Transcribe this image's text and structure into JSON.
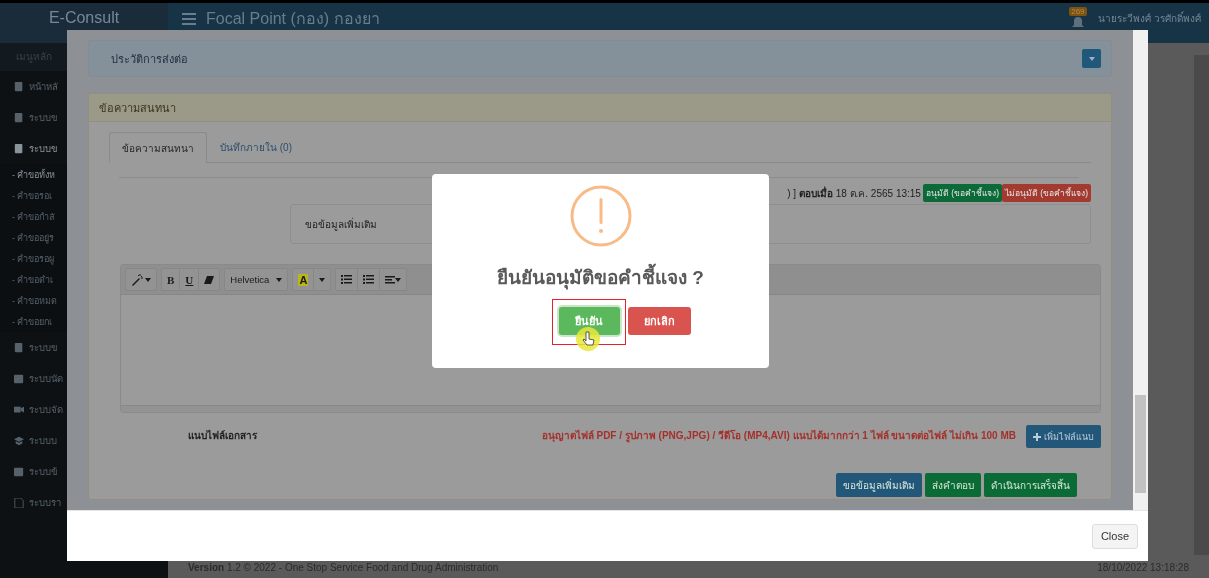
{
  "header": {
    "brand": "E-Consult",
    "title": "Focal Point (กอง) กองยา",
    "notification_count": "269",
    "user": "นายระวีพงศ์ วรศักดิ์พงศ์"
  },
  "sidebar": {
    "heading": "เมนูหลัก",
    "items": [
      {
        "kind": "main",
        "label": "หน้าหลั",
        "selected": false
      },
      {
        "kind": "main",
        "label": "ระบบข",
        "selected": false
      },
      {
        "kind": "main",
        "label": "ระบบข",
        "selected": true
      },
      {
        "kind": "sub",
        "label": "- คำขอทั้งห",
        "selected": true
      },
      {
        "kind": "sub",
        "label": "- คำขอรอเ",
        "selected": false
      },
      {
        "kind": "sub",
        "label": "- คำขอกำลั",
        "selected": false
      },
      {
        "kind": "sub",
        "label": "- คำขออยู่ร",
        "selected": false
      },
      {
        "kind": "sub",
        "label": "- คำขอรอผู",
        "selected": false
      },
      {
        "kind": "sub",
        "label": "- คำขอดำเ",
        "selected": false
      },
      {
        "kind": "sub",
        "label": "- คำขอหมด",
        "selected": false
      },
      {
        "kind": "sub",
        "label": "- คำขอยกเ",
        "selected": false
      },
      {
        "kind": "main",
        "label": "ระบบข",
        "selected": false
      },
      {
        "kind": "main",
        "label": "ระบบนัด",
        "selected": false
      },
      {
        "kind": "main",
        "label": "ระบบจัด",
        "selected": false
      },
      {
        "kind": "main",
        "label": "ระบบบ",
        "selected": false
      },
      {
        "kind": "main",
        "label": "ระบบข้",
        "selected": false
      },
      {
        "kind": "main",
        "label": "ระบบรา",
        "selected": false
      }
    ]
  },
  "modal": {
    "history_panel": {
      "title": "ประวัติการส่งต่อ"
    },
    "conversation_panel": {
      "title": "ข้อความสนทนา",
      "tabs": [
        {
          "label": "ข้อความสนทนา",
          "selected": true
        },
        {
          "label": "บันทึกภายใน (0)",
          "selected": false
        }
      ],
      "message": {
        "meta": ") ] **ตอบเมื่อ** 18 ต.ค. 2565 13:15",
        "badges": [
          {
            "label": "อนุมัติ (ขอคำชี้แจง)",
            "color": "#0b6a37"
          },
          {
            "label": "ไม่อนุมัติ (ขอคำชี้แจง)",
            "color": "#a33a30"
          }
        ],
        "body": "ขอข้อมูลเพิ่มเติม"
      },
      "editor": {
        "bold": "B",
        "underline": "U",
        "font": "Helvetica",
        "highlight_letter": "A"
      },
      "attachment": {
        "label": "แนบไฟล์เอกสาร",
        "hint": "อนุญาตไฟล์ PDF / รูปภาพ (PNG,JPG) / วีดีโอ (MP4,AVI) แนบได้มากกว่า 1 ไฟล์ ขนาดต่อไฟล์ ไม่เกิน 100 MB",
        "button": "เพิ่มไฟล์แนบ"
      },
      "actions": [
        {
          "label": "ขอข้อมูลเพิ่มเติม",
          "kind": "primary"
        },
        {
          "label": "ส่งคำตอบ",
          "kind": "success"
        },
        {
          "label": "ดำเนินการเสร็จสิ้น",
          "kind": "success"
        }
      ]
    },
    "close_button": "Close"
  },
  "dialog": {
    "title": "ยืนยันอนุมัติขอคำชี้แจง ?",
    "confirm": "ยืนยัน",
    "cancel": "ยกเลิก"
  },
  "footer": {
    "version": "**Version** 1.2 © 2022 - One Stop Service Food and Drug Administration",
    "timestamp": "18/10/2022 13:18:28"
  }
}
